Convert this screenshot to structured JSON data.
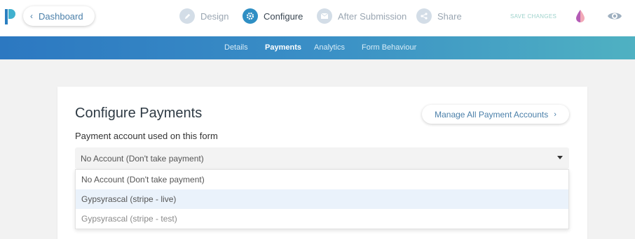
{
  "header": {
    "back_label": "Dashboard",
    "steps": [
      {
        "label": "Design",
        "icon": "pencil-icon"
      },
      {
        "label": "Configure",
        "icon": "gear-icon",
        "active": true
      },
      {
        "label": "After Submission",
        "icon": "envelope-icon"
      },
      {
        "label": "Share",
        "icon": "share-icon"
      }
    ],
    "save_label": "SAVE CHANGES"
  },
  "subnav": {
    "tabs": [
      {
        "label": "Details"
      },
      {
        "label": "Payments",
        "active": true
      },
      {
        "label": "Analytics"
      },
      {
        "label": "Form Behaviour"
      }
    ]
  },
  "main": {
    "title": "Configure Payments",
    "manage_label": "Manage All Payment Accounts",
    "field_label": "Payment account used on this form",
    "selected": "No Account (Don't take payment)",
    "options": [
      "No Account (Don't take payment)",
      "Gypsyrascal (stripe - live)",
      "Gypsyrascal (stripe - test)"
    ]
  },
  "colors": {
    "accent": "#2f8fc4",
    "link": "#4a7fa9",
    "save": "#9fd3cc",
    "highlight_row": "#eaf2fb"
  }
}
